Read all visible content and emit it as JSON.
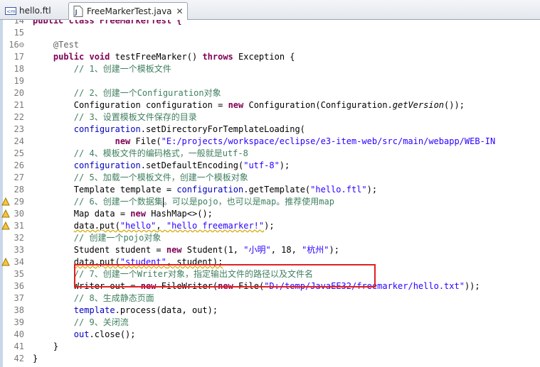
{
  "tabs": [
    {
      "label": "hello.ftl",
      "icon": "ftl-file-icon"
    },
    {
      "label": "FreeMarkerTest.java",
      "icon": "java-file-icon",
      "close": "✕"
    }
  ],
  "colors": {
    "keyword": "#7f0055",
    "comment": "#3f7f5f",
    "string": "#2a00ff",
    "highlight_box": "#e02020"
  },
  "line_numbers": [
    "14",
    "15",
    "16⊖",
    "17",
    "18",
    "19",
    "20",
    "21",
    "22",
    "23",
    "24",
    "25",
    "26",
    "27",
    "28",
    "29",
    "30",
    "31",
    "32",
    "33",
    "34",
    "35",
    "36",
    "37",
    "38",
    "39",
    "40",
    "41",
    "42"
  ],
  "code": {
    "l14": "public class FreeMarkerTest {",
    "l16": "@Test",
    "l17a": "public void",
    "l17b": " testFreeMarker() ",
    "l17c": "throws",
    "l17d": " Exception {",
    "l18": "// 1、创建一个模板文件",
    "l20": "// 2、创建一个Configuration对象",
    "l21a": "Configuration ",
    "l21b": "configuration",
    "l21c": " = ",
    "l21d": "new",
    "l21e": " Configuration(Configuration.",
    "l21f": "getVersion",
    "l21g": "());",
    "l22": "// 3、设置模板文件保存的目录",
    "l23a": "configuration",
    "l23b": ".setDirectoryForTemplateLoading(",
    "l24a": "new",
    "l24b": " File(",
    "l24c": "\"E:/projects/workspace/eclipse/e3-item-web/src/main/webapp/WEB-IN",
    "l25": "// 4、模板文件的编码格式，一般就是utf-8",
    "l26a": "configuration",
    "l26b": ".setDefaultEncoding(",
    "l26c": "\"utf-8\"",
    "l26d": ");",
    "l27": "// 5、加载一个模板文件，创建一个模板对象",
    "l28a": "Template ",
    "l28b": "template",
    "l28c": " = ",
    "l28d": "configuration",
    "l28e": ".getTemplate(",
    "l28f": "\"hello.ftl\"",
    "l28g": ");",
    "l29a": "// 6、创建一个数据集",
    "l29b": "。可以是pojo，也可以是map。推荐使用map",
    "l30a": "Map ",
    "l30b": "data",
    "l30c": " = ",
    "l30d": "new",
    "l30e": " HashMap<>();",
    "l31a": "data",
    "l31b": ".put(",
    "l31c": "\"hello\"",
    "l31d": ", ",
    "l31e": "\"hello freemarker!\"",
    "l31f": ");",
    "l32": "// 创建一个pojo对象",
    "l33a": "Student ",
    "l33b": "student",
    "l33c": " = ",
    "l33d": "new",
    "l33e": " Student(1, ",
    "l33f": "\"小明\"",
    "l33g": ", 18, ",
    "l33h": "\"杭州\"",
    "l33i": ");",
    "l34a": "data",
    "l34b": ".put(",
    "l34c": "\"student\"",
    "l34d": ", student);",
    "l35": "// 7、创建一个Writer对象，指定输出文件的路径以及文件名",
    "l36a": "Writer ",
    "l36b": "out",
    "l36c": " = ",
    "l36d": "new",
    "l36e": " FileWriter(",
    "l36f": "new",
    "l36g": " File(",
    "l36h": "\"D:/temp/JavaEE32/freemarker/hello.txt\"",
    "l36i": "));",
    "l37": "// 8、生成静态页面",
    "l38a": "template",
    "l38b": ".process(data, out);",
    "l39": "// 9、关闭流",
    "l40a": "out",
    "l40b": ".close();",
    "l41": "}",
    "l42": "}"
  }
}
